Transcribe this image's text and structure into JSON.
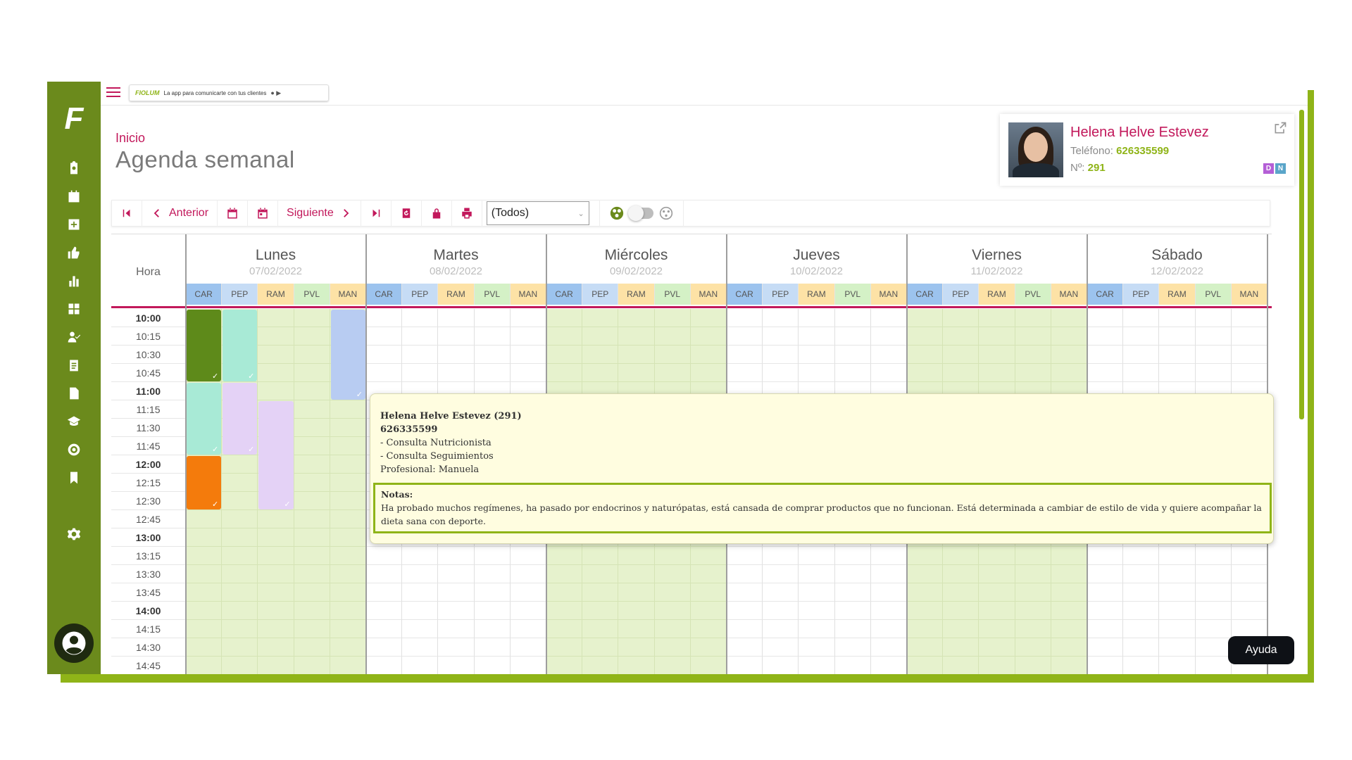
{
  "topbar": {
    "banner_brand": "FIOLUM",
    "banner_text": "La app para comunicarte con tus clientes"
  },
  "page": {
    "breadcrumb": "Inicio",
    "title": "Agenda semanal"
  },
  "patient": {
    "name": "Helena Helve Estevez",
    "phone_label": "Teléfono:",
    "phone": "626335599",
    "num_label": "Nº:",
    "num": "291",
    "badges": [
      "D",
      "N"
    ]
  },
  "toolbar": {
    "prev_label": "Anterior",
    "next_label": "Siguiente",
    "select_value": "(Todos)"
  },
  "calendar": {
    "hora_label": "Hora",
    "days": [
      {
        "name": "Lunes",
        "date": "07/02/2022"
      },
      {
        "name": "Martes",
        "date": "08/02/2022"
      },
      {
        "name": "Miércoles",
        "date": "09/02/2022"
      },
      {
        "name": "Jueves",
        "date": "10/02/2022"
      },
      {
        "name": "Viernes",
        "date": "11/02/2022"
      },
      {
        "name": "Sábado",
        "date": "12/02/2022"
      }
    ],
    "resources": [
      {
        "code": "CAR",
        "color": "#9cc3ee"
      },
      {
        "code": "PEP",
        "color": "#c6dcf5"
      },
      {
        "code": "RAM",
        "color": "#fde2a6"
      },
      {
        "code": "PVL",
        "color": "#d4f1c6"
      },
      {
        "code": "MAN",
        "color": "#fde2a6"
      }
    ],
    "times": [
      "10:00",
      "10:15",
      "10:30",
      "10:45",
      "11:00",
      "11:15",
      "11:30",
      "11:45",
      "12:00",
      "12:15",
      "12:30",
      "12:45",
      "13:00",
      "13:15",
      "13:30",
      "13:45",
      "14:00",
      "14:15",
      "14:30",
      "14:45"
    ],
    "green_days": [
      0,
      2,
      4
    ],
    "appointments": [
      {
        "day": 0,
        "col": 0,
        "start": 0,
        "span": 4,
        "color": "#5e8a1a"
      },
      {
        "day": 0,
        "col": 1,
        "start": 0,
        "span": 4,
        "color": "#a8ead6"
      },
      {
        "day": 0,
        "col": 4,
        "start": 0,
        "span": 5,
        "color": "#b8ccf2"
      },
      {
        "day": 0,
        "col": 0,
        "start": 4,
        "span": 4,
        "color": "#a8ead6"
      },
      {
        "day": 0,
        "col": 1,
        "start": 4,
        "span": 4,
        "color": "#e4d2f6"
      },
      {
        "day": 0,
        "col": 2,
        "start": 5,
        "span": 6,
        "color": "#e4d2f6"
      },
      {
        "day": 0,
        "col": 0,
        "start": 8,
        "span": 3,
        "color": "#f47b0c"
      }
    ]
  },
  "popup": {
    "title": "Helena Helve Estevez (291)",
    "phone": "626335599",
    "services": [
      "- Consulta Nutricionista",
      "- Consulta Seguimientos"
    ],
    "professional": "Profesional: Manuela",
    "notes_label": "Notas:",
    "notes": "Ha probado muchos regímenes, ha pasado por endocrinos y naturópatas, está cansada de comprar productos que no funcionan. Está determinada a cambiar de estilo de vida y quiere acompañar la dieta sana con deporte."
  },
  "help_button": "Ayuda",
  "colors": {
    "sidebar": "#6b8a1c",
    "accent": "#c2185b",
    "brand_green": "#8fb418"
  }
}
